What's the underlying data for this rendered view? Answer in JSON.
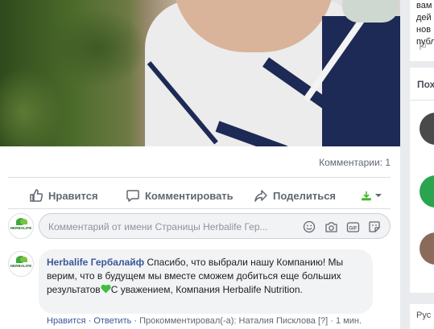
{
  "sidebar_right": {
    "top_lines": [
      "вам",
      "дей",
      "нов",
      "публ"
    ],
    "section_header": "Пох",
    "bottom_text": "Рус"
  },
  "post": {
    "comments_count": "Комментарии: 1",
    "actions": {
      "like": "Нравится",
      "comment": "Комментировать",
      "share": "Поделиться"
    },
    "composer": {
      "avatar_text": "HERBALIFE",
      "placeholder": "Комментарий от имени Страницы Herbalife Гер..."
    },
    "comment": {
      "avatar_text": "HERBALIFE",
      "author": "Herbalife Гербалайф",
      "text_part1": "Спасибо, что выбрали нашу Компанию! Мы верим, что в будущем мы вместе сможем добиться еще больших результатов",
      "text_part2": "С уважением, Компания Herbalife Nutrition.",
      "reply": "Нравится · Ответить · ",
      "commented_by_prefix": "Прокомментировал(-а): ",
      "commented_by_name": "Наталия Писклова",
      "tail": " [?] · 1 мин."
    }
  },
  "colors": {
    "link_blue": "#385898",
    "action_gray": "#606770",
    "bubble_bg": "#f2f3f5",
    "heart_green": "#3fbe3f"
  }
}
